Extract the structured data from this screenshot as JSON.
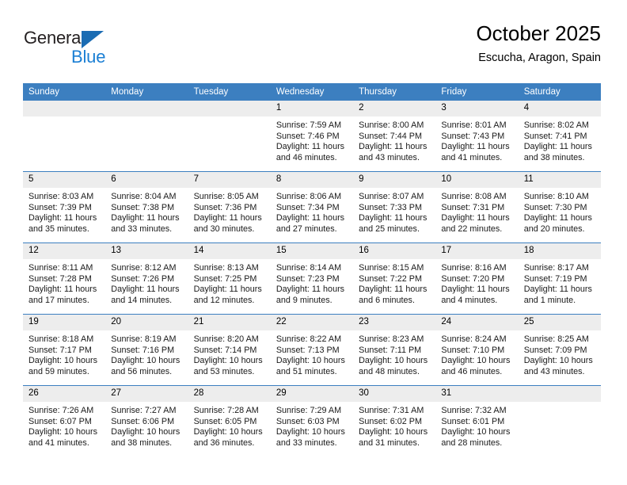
{
  "logo": {
    "word_one": "General",
    "word_two": "Blue",
    "mark": "triangle-logo-icon",
    "color_dark": "#231f20",
    "color_blue": "#1b7fd4",
    "color_mark": "#1b6cb3"
  },
  "header": {
    "title": "October 2025",
    "subtitle": "Escucha, Aragon, Spain"
  },
  "theme": {
    "header_bar": "#3c7fc0",
    "daynum_bg": "#ededed",
    "cell_bg": "#ffffff",
    "rule": "#3c7fc0"
  },
  "weekday_headers": [
    "Sunday",
    "Monday",
    "Tuesday",
    "Wednesday",
    "Thursday",
    "Friday",
    "Saturday"
  ],
  "weeks": [
    [
      {
        "day": "",
        "sunrise": "",
        "sunset": "",
        "daylight": "",
        "empty": true
      },
      {
        "day": "",
        "sunrise": "",
        "sunset": "",
        "daylight": "",
        "empty": true
      },
      {
        "day": "",
        "sunrise": "",
        "sunset": "",
        "daylight": "",
        "empty": true
      },
      {
        "day": "1",
        "sunrise": "Sunrise: 7:59 AM",
        "sunset": "Sunset: 7:46 PM",
        "daylight": "Daylight: 11 hours and 46 minutes."
      },
      {
        "day": "2",
        "sunrise": "Sunrise: 8:00 AM",
        "sunset": "Sunset: 7:44 PM",
        "daylight": "Daylight: 11 hours and 43 minutes."
      },
      {
        "day": "3",
        "sunrise": "Sunrise: 8:01 AM",
        "sunset": "Sunset: 7:43 PM",
        "daylight": "Daylight: 11 hours and 41 minutes."
      },
      {
        "day": "4",
        "sunrise": "Sunrise: 8:02 AM",
        "sunset": "Sunset: 7:41 PM",
        "daylight": "Daylight: 11 hours and 38 minutes."
      }
    ],
    [
      {
        "day": "5",
        "sunrise": "Sunrise: 8:03 AM",
        "sunset": "Sunset: 7:39 PM",
        "daylight": "Daylight: 11 hours and 35 minutes."
      },
      {
        "day": "6",
        "sunrise": "Sunrise: 8:04 AM",
        "sunset": "Sunset: 7:38 PM",
        "daylight": "Daylight: 11 hours and 33 minutes."
      },
      {
        "day": "7",
        "sunrise": "Sunrise: 8:05 AM",
        "sunset": "Sunset: 7:36 PM",
        "daylight": "Daylight: 11 hours and 30 minutes."
      },
      {
        "day": "8",
        "sunrise": "Sunrise: 8:06 AM",
        "sunset": "Sunset: 7:34 PM",
        "daylight": "Daylight: 11 hours and 27 minutes."
      },
      {
        "day": "9",
        "sunrise": "Sunrise: 8:07 AM",
        "sunset": "Sunset: 7:33 PM",
        "daylight": "Daylight: 11 hours and 25 minutes."
      },
      {
        "day": "10",
        "sunrise": "Sunrise: 8:08 AM",
        "sunset": "Sunset: 7:31 PM",
        "daylight": "Daylight: 11 hours and 22 minutes."
      },
      {
        "day": "11",
        "sunrise": "Sunrise: 8:10 AM",
        "sunset": "Sunset: 7:30 PM",
        "daylight": "Daylight: 11 hours and 20 minutes."
      }
    ],
    [
      {
        "day": "12",
        "sunrise": "Sunrise: 8:11 AM",
        "sunset": "Sunset: 7:28 PM",
        "daylight": "Daylight: 11 hours and 17 minutes."
      },
      {
        "day": "13",
        "sunrise": "Sunrise: 8:12 AM",
        "sunset": "Sunset: 7:26 PM",
        "daylight": "Daylight: 11 hours and 14 minutes."
      },
      {
        "day": "14",
        "sunrise": "Sunrise: 8:13 AM",
        "sunset": "Sunset: 7:25 PM",
        "daylight": "Daylight: 11 hours and 12 minutes."
      },
      {
        "day": "15",
        "sunrise": "Sunrise: 8:14 AM",
        "sunset": "Sunset: 7:23 PM",
        "daylight": "Daylight: 11 hours and 9 minutes."
      },
      {
        "day": "16",
        "sunrise": "Sunrise: 8:15 AM",
        "sunset": "Sunset: 7:22 PM",
        "daylight": "Daylight: 11 hours and 6 minutes."
      },
      {
        "day": "17",
        "sunrise": "Sunrise: 8:16 AM",
        "sunset": "Sunset: 7:20 PM",
        "daylight": "Daylight: 11 hours and 4 minutes."
      },
      {
        "day": "18",
        "sunrise": "Sunrise: 8:17 AM",
        "sunset": "Sunset: 7:19 PM",
        "daylight": "Daylight: 11 hours and 1 minute."
      }
    ],
    [
      {
        "day": "19",
        "sunrise": "Sunrise: 8:18 AM",
        "sunset": "Sunset: 7:17 PM",
        "daylight": "Daylight: 10 hours and 59 minutes."
      },
      {
        "day": "20",
        "sunrise": "Sunrise: 8:19 AM",
        "sunset": "Sunset: 7:16 PM",
        "daylight": "Daylight: 10 hours and 56 minutes."
      },
      {
        "day": "21",
        "sunrise": "Sunrise: 8:20 AM",
        "sunset": "Sunset: 7:14 PM",
        "daylight": "Daylight: 10 hours and 53 minutes."
      },
      {
        "day": "22",
        "sunrise": "Sunrise: 8:22 AM",
        "sunset": "Sunset: 7:13 PM",
        "daylight": "Daylight: 10 hours and 51 minutes."
      },
      {
        "day": "23",
        "sunrise": "Sunrise: 8:23 AM",
        "sunset": "Sunset: 7:11 PM",
        "daylight": "Daylight: 10 hours and 48 minutes."
      },
      {
        "day": "24",
        "sunrise": "Sunrise: 8:24 AM",
        "sunset": "Sunset: 7:10 PM",
        "daylight": "Daylight: 10 hours and 46 minutes."
      },
      {
        "day": "25",
        "sunrise": "Sunrise: 8:25 AM",
        "sunset": "Sunset: 7:09 PM",
        "daylight": "Daylight: 10 hours and 43 minutes."
      }
    ],
    [
      {
        "day": "26",
        "sunrise": "Sunrise: 7:26 AM",
        "sunset": "Sunset: 6:07 PM",
        "daylight": "Daylight: 10 hours and 41 minutes."
      },
      {
        "day": "27",
        "sunrise": "Sunrise: 7:27 AM",
        "sunset": "Sunset: 6:06 PM",
        "daylight": "Daylight: 10 hours and 38 minutes."
      },
      {
        "day": "28",
        "sunrise": "Sunrise: 7:28 AM",
        "sunset": "Sunset: 6:05 PM",
        "daylight": "Daylight: 10 hours and 36 minutes."
      },
      {
        "day": "29",
        "sunrise": "Sunrise: 7:29 AM",
        "sunset": "Sunset: 6:03 PM",
        "daylight": "Daylight: 10 hours and 33 minutes."
      },
      {
        "day": "30",
        "sunrise": "Sunrise: 7:31 AM",
        "sunset": "Sunset: 6:02 PM",
        "daylight": "Daylight: 10 hours and 31 minutes."
      },
      {
        "day": "31",
        "sunrise": "Sunrise: 7:32 AM",
        "sunset": "Sunset: 6:01 PM",
        "daylight": "Daylight: 10 hours and 28 minutes."
      },
      {
        "day": "",
        "sunrise": "",
        "sunset": "",
        "daylight": "",
        "empty": true
      }
    ]
  ]
}
